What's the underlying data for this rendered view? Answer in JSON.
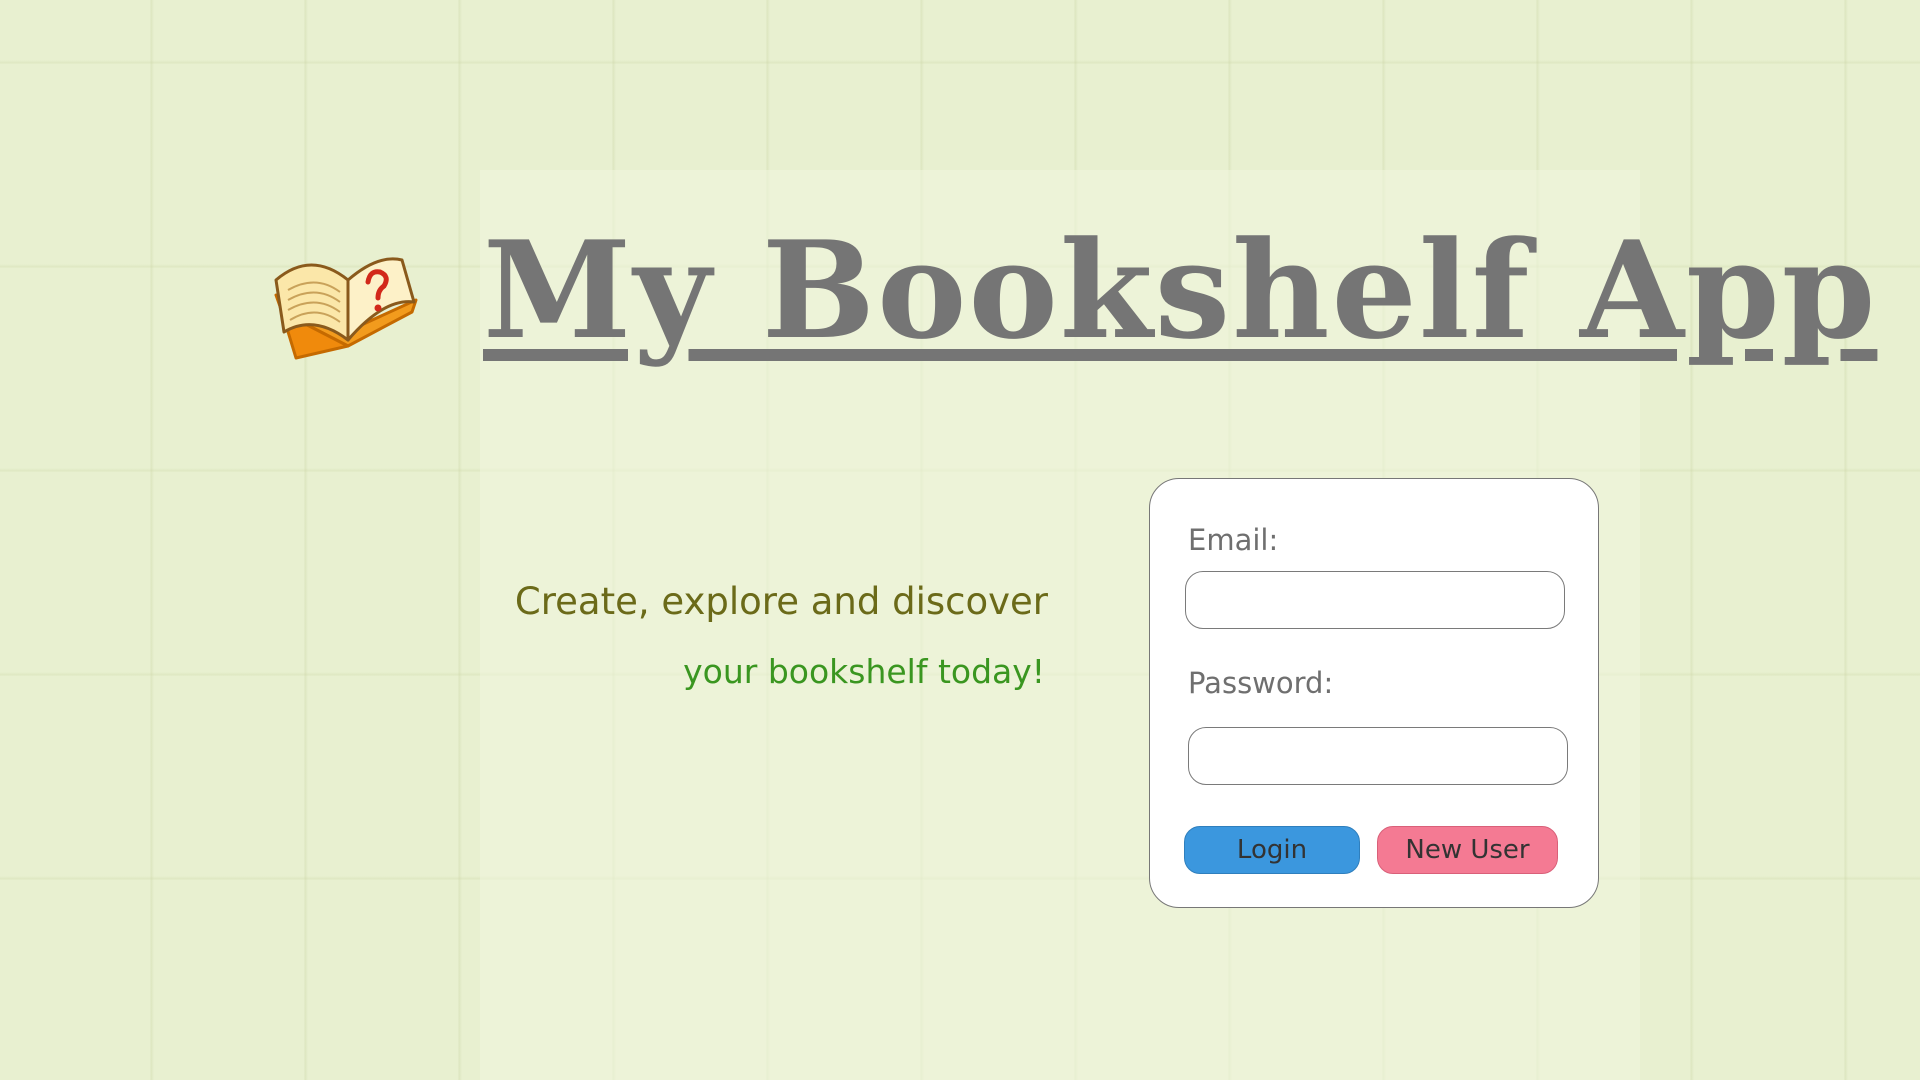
{
  "app": {
    "title": "My Bookshelf App",
    "logo_icon": "open-book-question-icon"
  },
  "tagline": {
    "line1": "Create, explore and discover",
    "line2": "your bookshelf today!"
  },
  "login_form": {
    "email_label": "Email:",
    "email_value": "",
    "password_label": "Password:",
    "password_value": "",
    "login_button": "Login",
    "new_user_button": "New User"
  },
  "colors": {
    "background": "#e9f1d2",
    "title": "#757575",
    "tagline_primary": "#6b6a19",
    "tagline_secondary": "#3a9620",
    "login_button": "#3b97de",
    "new_user_button": "#f47a93"
  }
}
